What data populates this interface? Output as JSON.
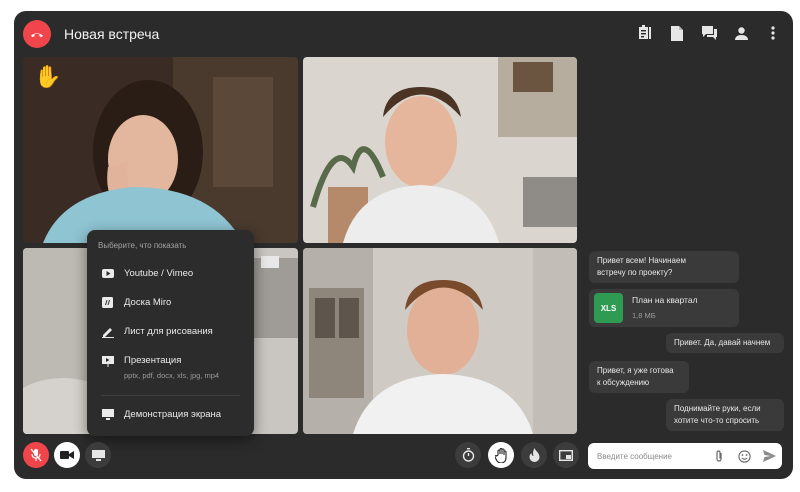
{
  "header": {
    "title": "Новая встреча",
    "icons": [
      "end-call-icon",
      "notes-icon",
      "document-icon",
      "chat-icon",
      "person-icon",
      "more-vert-icon"
    ]
  },
  "participants": [
    {
      "role": "woman-with-raised-hand",
      "hand_raised": true
    },
    {
      "role": "man-top-right",
      "hand_raised": false
    },
    {
      "role": "screen-share-behind-menu",
      "hand_raised": false
    },
    {
      "role": "man-bottom-right",
      "hand_raised": false
    }
  ],
  "raised_hand_emoji": "✋",
  "share_menu": {
    "heading": "Выберите, что показать",
    "items": [
      {
        "label": "Youtube / Vimeo",
        "icon": "play-icon"
      },
      {
        "label": "Доска Miro",
        "icon": "board-icon"
      },
      {
        "label": "Лист для рисования",
        "icon": "pencil-icon"
      },
      {
        "label": "Презентация",
        "icon": "presentation-icon",
        "sub": "pptx, pdf, docx, xls, jpg, mp4"
      },
      {
        "label": "Демонстрация экрана",
        "icon": "monitor-icon"
      }
    ]
  },
  "controls": {
    "left": [
      "mic-off-icon",
      "camera-icon",
      "screen-share-icon"
    ],
    "center": [
      "timer-icon",
      "raise-hand-icon",
      "fire-icon",
      "picture-in-picture-icon"
    ]
  },
  "chat": {
    "messages": [
      {
        "side": "left",
        "text_lines": [
          "Привет всем! Начинаем",
          "встречу по проекту?"
        ]
      },
      {
        "side": "left",
        "file": {
          "type_label": "XLS",
          "name": "План на квартал",
          "size": "1,8 МБ"
        }
      },
      {
        "side": "right",
        "text_lines": [
          "Привет. Да, давай начнем"
        ]
      },
      {
        "side": "left",
        "text_lines": [
          "Привет, я уже готова",
          "к обсуждению"
        ]
      },
      {
        "side": "right",
        "text_lines": [
          "Поднимайте руки, если",
          "хотите что-то спросить"
        ]
      }
    ],
    "input": {
      "placeholder": "Введите сообщение",
      "value": ""
    }
  },
  "colors": {
    "window_bg": "#2b2b2b",
    "end_call_red": "#f0464b",
    "bubble_bg": "#3a3a3a",
    "xls_green": "#2f9a52"
  }
}
